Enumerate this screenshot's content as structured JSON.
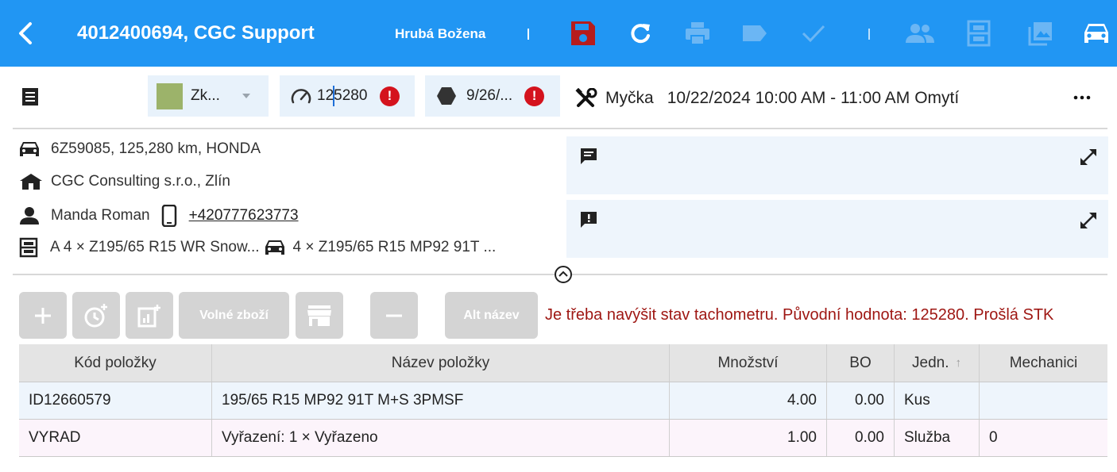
{
  "appbar": {
    "title": "4012400694, CGC Support",
    "user": "Hrubá Božena"
  },
  "header": {
    "status_label": "Zk...",
    "status_color": "#9cb36a",
    "odometer_value": "125280",
    "date_value": "9/26/...",
    "error_mark": "!",
    "appointment_place": "Myčka",
    "appointment_time": "10/22/2024 10:00 AM - 11:00 AM",
    "appointment_service": "Omytí"
  },
  "info": {
    "vehicle": "6Z59085, 125,280 km, HONDA",
    "company": "CGC Consulting s.r.o., Zlín",
    "contact_name": "Manda Roman",
    "phone": "+420777623773",
    "storage_tires": "A 4 × Z195/65 R15 WR Snow...",
    "mounted_tires": "4 × Z195/65 R15 MP92 91T ..."
  },
  "toolbar": {
    "free_goods_label": "Volné zboží",
    "alt_name_label": "Alt název",
    "warning": "Je třeba navýšit stav tachometru. Původní hodnota: 125280. Prošlá STK"
  },
  "table": {
    "columns": [
      "Kód položky",
      "Název položky",
      "Množství",
      "BO",
      "Jedn.",
      "Mechanici"
    ],
    "rows": [
      [
        "ID12660579",
        "195/65 R15 MP92 91T M+S 3PMSF",
        "4.00",
        "0.00",
        "Kus",
        ""
      ],
      [
        "VYRAD",
        "Vyřazení: 1 × Vyřazeno",
        "1.00",
        "0.00",
        "Služba",
        "0"
      ]
    ]
  },
  "colors": {
    "appbar": "#2196f3",
    "save_icon": "#b71c1c",
    "error": "#d4131d",
    "warning_text": "#9e1612"
  }
}
